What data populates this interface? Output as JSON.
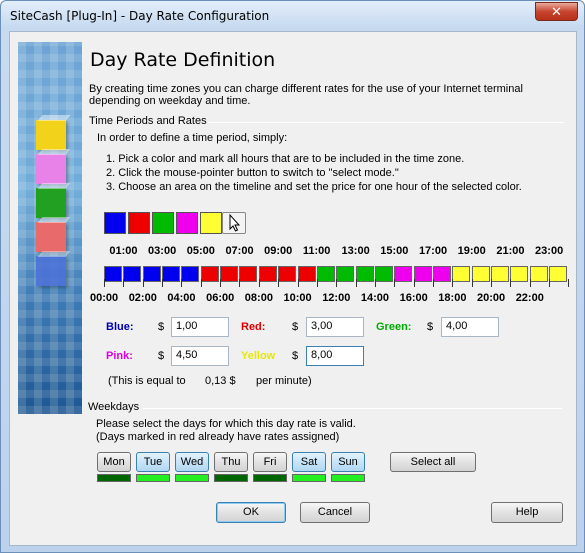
{
  "window": {
    "title": "SiteCash [Plug-In] - Day Rate Configuration",
    "close_glyph": "✕"
  },
  "header": {
    "title": "Day Rate Definition",
    "description_line1": "By creating time zones you can charge different rates for the use of your Internet terminal",
    "description_line2": "depending on weekday and time."
  },
  "periods": {
    "section_label": "Time Periods and Rates",
    "intro": "In order to define a time period, simply:",
    "steps": [
      "1. Pick a color and mark all hours that are to be included in the time zone.",
      "2. Click the mouse-pointer button to switch to \"select mode.\"",
      "3. Choose an area on the timeline and set the price for one hour of the selected color."
    ]
  },
  "colors": {
    "blue": "#0000ee",
    "red": "#ee0000",
    "green": "#00bb00",
    "pink": "#ee00ee",
    "yellow": "#ffff33",
    "blue_text": "#0000aa",
    "red_text": "#dd0000",
    "green_text": "#00aa00",
    "pink_text": "#dd00dd",
    "yellow_text": "#e8e800",
    "day_dark": "#006600",
    "day_light": "#22ee22"
  },
  "palette": [
    "blue",
    "red",
    "green",
    "pink",
    "yellow"
  ],
  "timeline": {
    "odd_hours": [
      "01:00",
      "03:00",
      "05:00",
      "07:00",
      "09:00",
      "11:00",
      "13:00",
      "15:00",
      "17:00",
      "19:00",
      "21:00",
      "23:00"
    ],
    "even_hours": [
      "00:00",
      "02:00",
      "04:00",
      "06:00",
      "08:00",
      "10:00",
      "12:00",
      "14:00",
      "16:00",
      "18:00",
      "20:00",
      "22:00"
    ],
    "hour_colors": [
      "blue",
      "blue",
      "blue",
      "blue",
      "blue",
      "red",
      "red",
      "red",
      "red",
      "red",
      "red",
      "green",
      "green",
      "green",
      "green",
      "pink",
      "pink",
      "pink",
      "yellow",
      "yellow",
      "yellow",
      "yellow",
      "yellow",
      "yellow"
    ]
  },
  "rates": {
    "currency": "$",
    "blue": {
      "label": "Blue:",
      "value": "1,00"
    },
    "red": {
      "label": "Red:",
      "value": "3,00"
    },
    "green": {
      "label": "Green:",
      "value": "4,00"
    },
    "pink": {
      "label": "Pink:",
      "value": "4,50"
    },
    "yellow": {
      "label": "Yellow",
      "value": "8,00"
    },
    "equal_prefix": "(This is equal to",
    "equal_value": "0,13 $",
    "equal_suffix": "per minute)"
  },
  "weekdays": {
    "section_label": "Weekdays",
    "instruction1": "Please select the days for which this day rate is valid.",
    "instruction2": "(Days marked in red already have rates assigned)",
    "days": [
      {
        "label": "Mon",
        "pressed": false,
        "bar": "day_dark"
      },
      {
        "label": "Tue",
        "pressed": true,
        "bar": "day_light"
      },
      {
        "label": "Wed",
        "pressed": true,
        "bar": "day_light"
      },
      {
        "label": "Thu",
        "pressed": false,
        "bar": "day_dark"
      },
      {
        "label": "Fri",
        "pressed": false,
        "bar": "day_dark"
      },
      {
        "label": "Sat",
        "pressed": true,
        "bar": "day_light"
      },
      {
        "label": "Sun",
        "pressed": true,
        "bar": "day_light"
      }
    ],
    "select_all": "Select all"
  },
  "footer": {
    "ok": "OK",
    "cancel": "Cancel",
    "help": "Help"
  },
  "icons": {
    "banner_cubes": [
      "cube-yellow",
      "cube-pink",
      "cube-green",
      "cube-red",
      "cube-blue"
    ],
    "pointer": "mouse-pointer-icon"
  }
}
